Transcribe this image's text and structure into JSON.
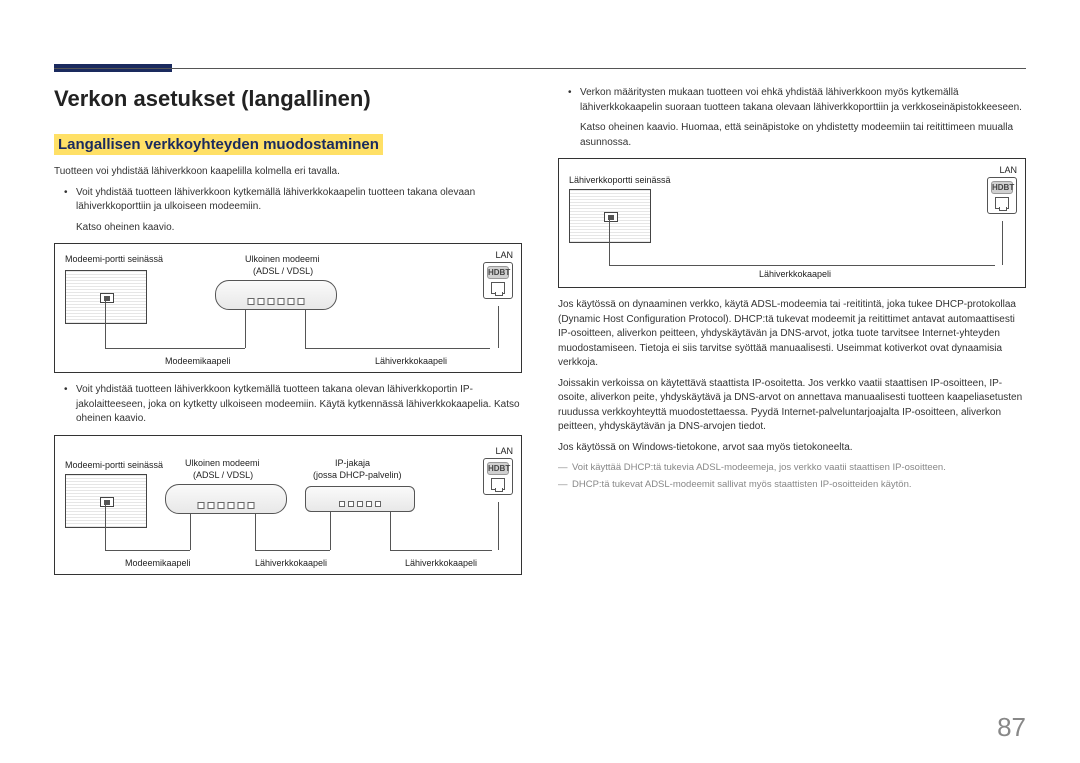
{
  "page_number": "87",
  "headings": {
    "h1": "Verkon asetukset (langallinen)",
    "h2": "Langallisen verkkoyhteyden muodostaminen"
  },
  "left": {
    "intro": "Tuotteen voi yhdistää lähiverkkoon kaapelilla kolmella eri tavalla.",
    "bullet1": "Voit yhdistää tuotteen lähiverkkoon kytkemällä lähiverkkokaapelin tuotteen takana olevaan lähiverkkoporttiin ja ulkoiseen modeemiin.",
    "bullet1_sub": "Katso oheinen kaavio.",
    "bullet2": "Voit yhdistää tuotteen lähiverkkoon kytkemällä tuotteen takana olevan lähiverkkoportin IP-jakolaitteeseen, joka on kytketty ulkoiseen modeemiin. Käytä kytkennässä lähiverkkokaapelia. Katso oheinen kaavio."
  },
  "diagram_labels": {
    "modem_wall_port": "Modeemi-portti seinässä",
    "lan_wall_port": "Lähiverkkoportti seinässä",
    "external_modem": "Ulkoinen modeemi",
    "adsl_vdsl": "(ADSL / VDSL)",
    "ip_sharer": "IP-jakaja",
    "ip_sharer_sub": "(jossa DHCP-palvelin)",
    "modem_cable": "Modeemikaapeli",
    "lan_cable": "Lähiverkkokaapeli",
    "lan": "LAN",
    "hdbt": "HDBT"
  },
  "right": {
    "bullet1": "Verkon määritysten mukaan tuotteen voi ehkä yhdistää lähiverkkoon myös kytkemällä lähiverkkokaapelin suoraan tuotteen takana olevaan lähiverkkoporttiin ja verkkoseinäpistokkeeseen.",
    "bullet1_sub": "Katso oheinen kaavio. Huomaa, että seinäpistoke on yhdistetty modeemiin tai reitittimeen muualla asunnossa.",
    "para2": "Jos käytössä on dynaaminen verkko, käytä ADSL-modeemia tai -reititintä, joka tukee DHCP-protokollaa (Dynamic Host Configuration Protocol). DHCP:tä tukevat modeemit ja reitittimet antavat automaattisesti IP-osoitteen, aliverkon peitteen, yhdyskäytävän ja DNS-arvot, jotka tuote tarvitsee Internet-yhteyden muodostamiseen. Tietoja ei siis tarvitse syöttää manuaalisesti. Useimmat kotiverkot ovat dynaamisia verkkoja.",
    "para3": "Joissakin verkoissa on käytettävä staattista IP-osoitetta. Jos verkko vaatii staattisen IP-osoitteen, IP-osoite, aliverkon peite, yhdyskäytävä ja DNS-arvot on annettava manuaalisesti tuotteen kaapeliasetusten ruudussa verkkoyhteyttä muodostettaessa. Pyydä Internet-palveluntarjoajalta IP-osoitteen, aliverkon peitteen, yhdyskäytävän ja DNS-arvojen tiedot.",
    "para4": "Jos käytössä on Windows-tietokone, arvot saa myös tietokoneelta.",
    "note1": "Voit käyttää DHCP:tä tukevia ADSL-modeemeja, jos verkko vaatii staattisen IP-osoitteen.",
    "note2": "DHCP:tä tukevat ADSL-modeemit sallivat myös staattisten IP-osoitteiden käytön."
  }
}
